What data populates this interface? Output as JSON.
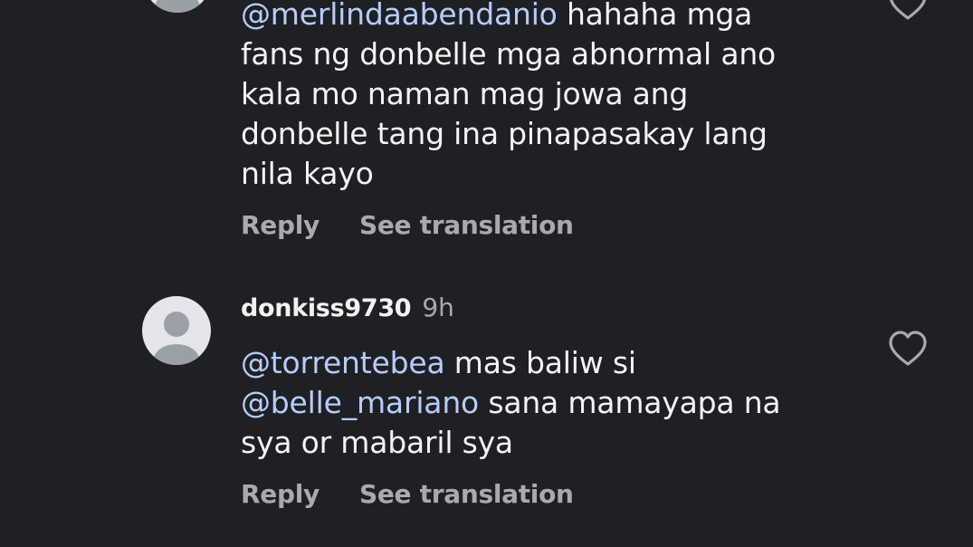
{
  "colors": {
    "background": "#1f2024",
    "text": "#f3f3f3",
    "mention": "#b5cdf9",
    "secondary": "#a9aaae",
    "avatar_bg": "#e4e6ea",
    "avatar_fg": "#9aa0a8"
  },
  "comments": [
    {
      "avatar_icon": "default-avatar-icon",
      "mention": "@merlindaabendanio",
      "lines": [
        " hahaha mga",
        "fans ng donbelle mga abnormal ano",
        "kala mo naman mag jowa ang",
        "donbelle tang ina pinapasakay lang",
        "nila kayo"
      ],
      "reply_label": "Reply",
      "translate_label": "See translation",
      "like_icon": "heart-outline-icon"
    },
    {
      "avatar_icon": "default-avatar-icon",
      "username": "donkiss9730",
      "time": "9h",
      "mention_1": "@torrentebea",
      "text_1": " mas baliw si",
      "mention_2": "@belle_mariano",
      "text_2": " sana mamayapa na",
      "text_3": "sya or mabaril sya",
      "reply_label": "Reply",
      "translate_label": "See translation",
      "like_icon": "heart-outline-icon"
    }
  ]
}
